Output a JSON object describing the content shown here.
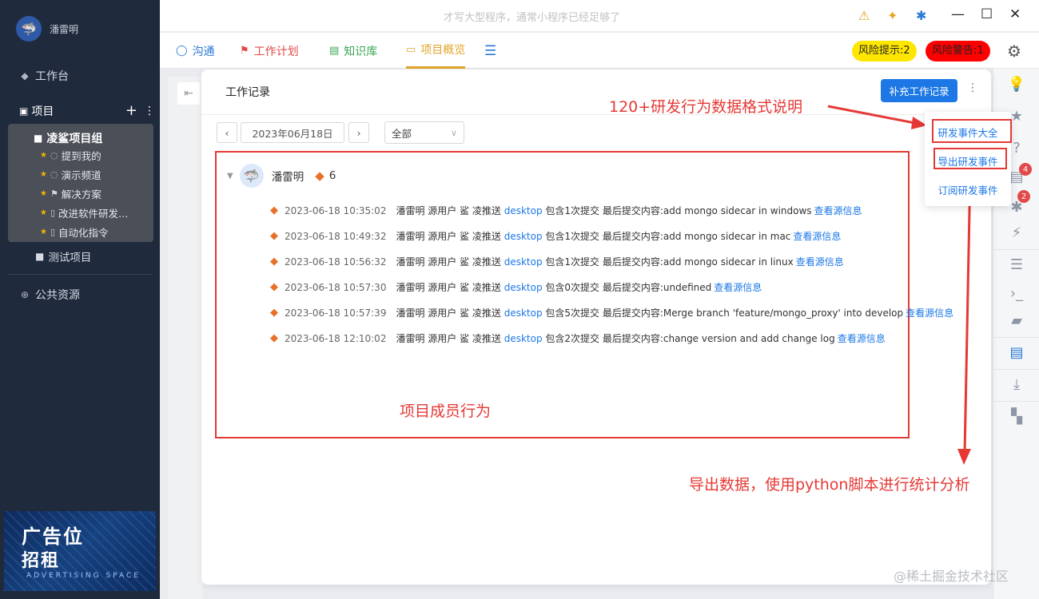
{
  "app": {
    "title": "才写大型程序，通常小程序已经足够了"
  },
  "sidebar": {
    "username": "潘雷明",
    "workbench": "工作台",
    "projects_label": "项目",
    "group": {
      "title": "凌鲨项目组",
      "items": [
        "提到我的",
        "演示频道",
        "解决方案",
        "改进软件研发…",
        "自动化指令"
      ]
    },
    "test_project": "测试项目",
    "public_resources": "公共资源",
    "ad": {
      "line1": "广告位",
      "line2": "招租",
      "line3": "ADVERTISING SPACE"
    }
  },
  "tabs": [
    "沟通",
    "工作计划",
    "知识库",
    "项目概览"
  ],
  "risk": {
    "hint": "风险提示:2",
    "warning": "风险警告:1"
  },
  "panel": {
    "title": "工作记录",
    "add_button": "补充工作记录",
    "date": "2023年06月18日",
    "filter": "全部",
    "member": {
      "name": "潘雷明",
      "count": "6"
    },
    "logs": [
      {
        "time": "2023-06-18 10:35:02",
        "before": "潘雷明 源用户 鲨 凌推送 ",
        "repo": "desktop",
        "after": " 包含1次提交 最后提交内容:add mongo sidecar in windows",
        "link": "查看源信息"
      },
      {
        "time": "2023-06-18 10:49:32",
        "before": "潘雷明 源用户 鲨 凌推送 ",
        "repo": "desktop",
        "after": " 包含1次提交 最后提交内容:add mongo sidecar in mac",
        "link": "查看源信息"
      },
      {
        "time": "2023-06-18 10:56:32",
        "before": "潘雷明 源用户 鲨 凌推送 ",
        "repo": "desktop",
        "after": " 包含1次提交 最后提交内容:add mongo sidecar in linux",
        "link": "查看源信息"
      },
      {
        "time": "2023-06-18 10:57:30",
        "before": "潘雷明 源用户 鲨 凌推送 ",
        "repo": "desktop",
        "after": " 包含0次提交 最后提交内容:undefined",
        "link": "查看源信息"
      },
      {
        "time": "2023-06-18 10:57:39",
        "before": "潘雷明 源用户 鲨 凌推送 ",
        "repo": "desktop",
        "after": " 包含5次提交 最后提交内容:Merge branch 'feature/mongo_proxy' into develop",
        "link": "查看源信息"
      },
      {
        "time": "2023-06-18 12:10:02",
        "before": "潘雷明 源用户 鲨 凌推送 ",
        "repo": "desktop",
        "after": " 包含2次提交 最后提交内容:change version and add change log",
        "link": "查看源信息"
      }
    ]
  },
  "dropdown": [
    "研发事件大全",
    "导出研发事件",
    "订阅研发事件"
  ],
  "annotations": {
    "format": "120+研发行为数据格式说明",
    "member_behavior": "项目成员行为",
    "export": "导出数据，使用python脚本进行统计分析"
  },
  "rail": {
    "badge1": "4",
    "badge2": "2"
  },
  "watermark": "@稀土掘金技术社区"
}
